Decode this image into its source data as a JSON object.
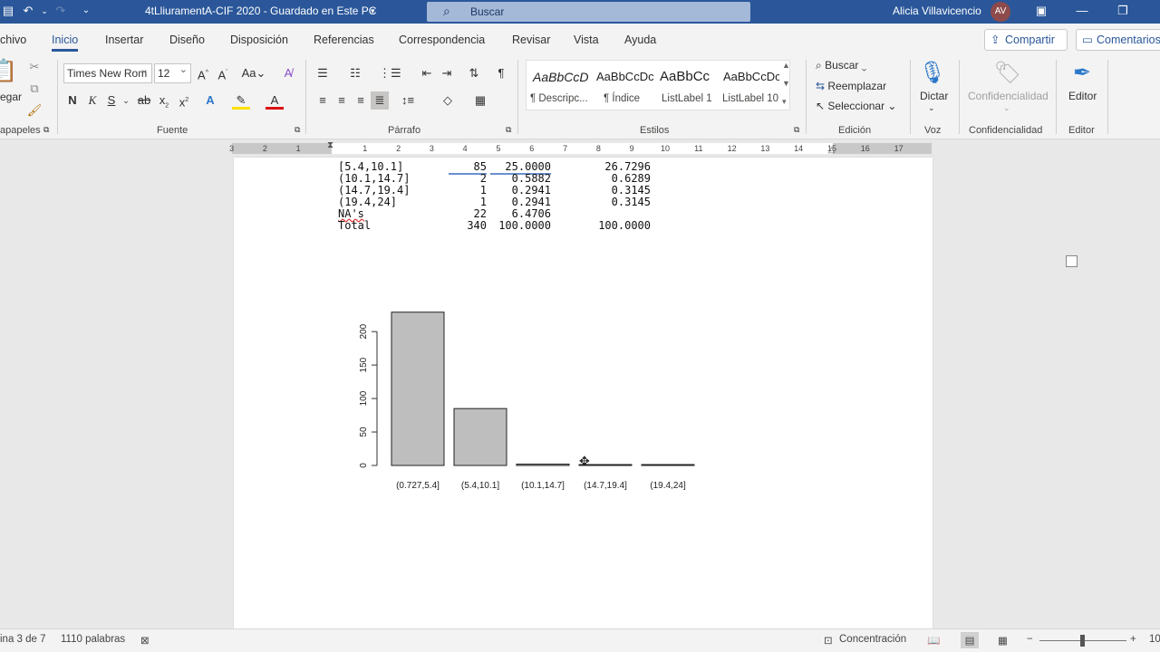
{
  "titlebar": {
    "doc_title": "4tLliuramentA-CIF 2020  -  Guardado en Este PC",
    "search_placeholder": "Buscar",
    "user_name": "Alicia Villavicencio",
    "user_initials": "AV"
  },
  "tabs": [
    "chivo",
    "Inicio",
    "Insertar",
    "Diseño",
    "Disposición",
    "Referencias",
    "Correspondencia",
    "Revisar",
    "Vista",
    "Ayuda"
  ],
  "active_tab": "Inicio",
  "share_label": "Compartir",
  "comments_label": "Comentarios",
  "ribbon": {
    "paste_label": "egar",
    "clipboard_label": "apapeles",
    "font_name": "Times New Rom",
    "font_size": "12",
    "font_group_label": "Fuente",
    "paragraph_group_label": "Párrafo",
    "styles": [
      {
        "preview": "AaBbCcD",
        "name": "¶ Descripc..."
      },
      {
        "preview": "AaBbCcDc",
        "name": "¶ Índice"
      },
      {
        "preview": "AaBbCc",
        "name": "ListLabel 1"
      },
      {
        "preview": "AaBbCcDc",
        "name": "ListLabel 10"
      }
    ],
    "styles_group_label": "Estilos",
    "edit_search": "Buscar",
    "edit_replace": "Reemplazar",
    "edit_select": "Seleccionar",
    "edit_group_label": "Edición",
    "dictate_label": "Dictar",
    "voice_group_label": "Voz",
    "confidential_label": "Confidencialidad",
    "confidential_group_label": "Confidencialidad",
    "editor_label": "Editor",
    "editor_group_label": "Editor"
  },
  "ruler_numbers": [
    "3",
    "2",
    "1",
    "1",
    "2",
    "3",
    "4",
    "5",
    "6",
    "7",
    "8",
    "9",
    "10",
    "11",
    "12",
    "13",
    "14",
    "15",
    "16",
    "17"
  ],
  "table_rows": [
    {
      "interval": "[5.4,10.1]",
      "n": "85",
      "pct": "25.0000",
      "valid": "26.7296"
    },
    {
      "interval": "(10.1,14.7]",
      "n": "2",
      "pct": "0.5882",
      "valid": "0.6289"
    },
    {
      "interval": "(14.7,19.4]",
      "n": "1",
      "pct": "0.2941",
      "valid": "0.3145"
    },
    {
      "interval": "(19.4,24]",
      "n": "1",
      "pct": "0.2941",
      "valid": "0.3145"
    },
    {
      "interval": "NA's",
      "n": "22",
      "pct": "6.4706",
      "valid": ""
    },
    {
      "interval": "Total",
      "n": "340",
      "pct": "100.0000",
      "valid": "100.0000"
    }
  ],
  "chart_data": {
    "type": "bar",
    "categories": [
      "(0.727,5.4]",
      "(5.4,10.1]",
      "(10.1,14.7]",
      "(14.7,19.4]",
      "(19.4,24]"
    ],
    "values": [
      229,
      85,
      2,
      1,
      1
    ],
    "y_ticks": [
      "0",
      "50",
      "100",
      "150",
      "200"
    ],
    "ylim": [
      0,
      230
    ],
    "bar_color": "#bebebe"
  },
  "status": {
    "page": "ina 3 de 7",
    "words": "1110 palabras",
    "focus": "Concentración",
    "zoom": "10"
  },
  "colors": {
    "word_blue": "#2b579a"
  }
}
